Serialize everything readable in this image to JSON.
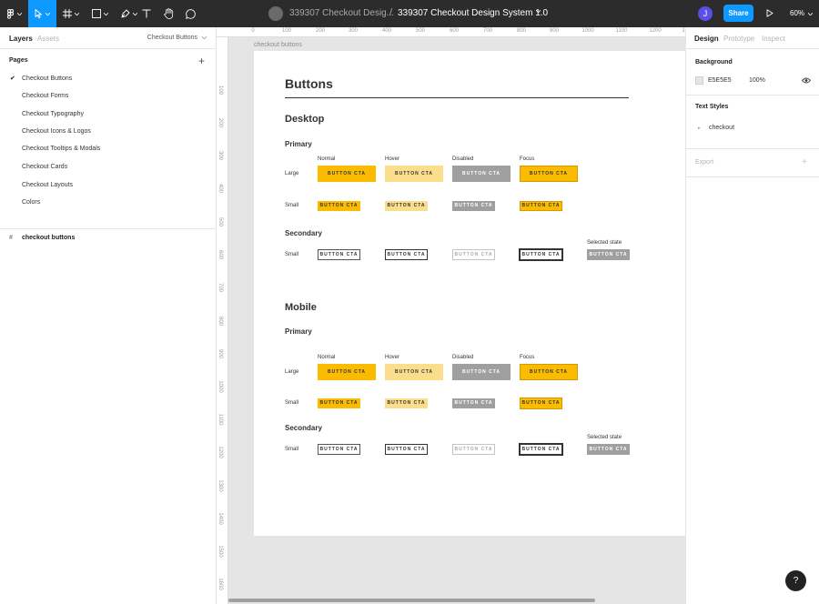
{
  "toolbar": {
    "tools": [
      {
        "name": "main-menu",
        "icon": "figma-logo-icon"
      },
      {
        "name": "move-tool",
        "icon": "pointer-icon"
      },
      {
        "name": "frame-tool",
        "icon": "frame-icon"
      },
      {
        "name": "shape-tool",
        "icon": "rectangle-icon"
      },
      {
        "name": "pen-tool",
        "icon": "pen-icon"
      },
      {
        "name": "text-tool",
        "icon": "text-icon"
      },
      {
        "name": "hand-tool",
        "icon": "hand-icon"
      },
      {
        "name": "comment-tool",
        "icon": "comment-icon"
      }
    ],
    "project_title": "339307 Checkout Desig...",
    "separator": "/",
    "file_title": "339307 Checkout Design System 1.0",
    "user_initial": "J",
    "share_label": "Share",
    "zoom_label": "60%",
    "accent_color": "#0d99ff"
  },
  "left_panel": {
    "tabs": [
      "Layers",
      "Assets"
    ],
    "current_page_select": "Checkout Buttons",
    "pages_heading": "Pages",
    "pages": [
      {
        "label": "Checkout Buttons",
        "current": true
      },
      {
        "label": "Checkout Forms"
      },
      {
        "label": "Checkout Typography"
      },
      {
        "label": "Checkout Icons & Logos"
      },
      {
        "label": "Checkout Tooltips & Modals"
      },
      {
        "label": "Checkout Cards"
      },
      {
        "label": "Checkout Layouts"
      },
      {
        "label": "Colors"
      }
    ],
    "layers": [
      {
        "label": "checkout buttons",
        "icon": "frame-hash-icon"
      }
    ]
  },
  "rulers": {
    "top": [
      "0",
      "100",
      "200",
      "300",
      "400",
      "500",
      "600",
      "700",
      "800",
      "900",
      "1000",
      "1100",
      "1200",
      "1"
    ],
    "left": [
      "100",
      "200",
      "300",
      "400",
      "500",
      "600",
      "700",
      "800",
      "900",
      "1000",
      "1100",
      "1200",
      "1300",
      "1400",
      "1500",
      "1600"
    ]
  },
  "canvas": {
    "frame_label": "checkout buttons",
    "title": "Buttons",
    "desktop_heading": "Desktop",
    "mobile_heading": "Mobile",
    "primary_label": "Primary",
    "secondary_label": "Secondary",
    "states": [
      "Normal",
      "Hover",
      "Disabled",
      "Focus"
    ],
    "selected_state_label": "Selected state",
    "size_large": "Large",
    "size_small": "Small",
    "button_text": "BUTTON CTA",
    "primary_color": "#fbbb00",
    "hover_color": "#fbde8c",
    "disabled_color": "#9f9f9f"
  },
  "right_panel": {
    "tabs": [
      "Design",
      "Prototype",
      "Inspect"
    ],
    "background_heading": "Background",
    "background_hex": "E5E5E5",
    "background_opacity": "100%",
    "text_styles_heading": "Text Styles",
    "text_style_item": "checkout",
    "export_heading": "Export"
  },
  "help_label": "?"
}
